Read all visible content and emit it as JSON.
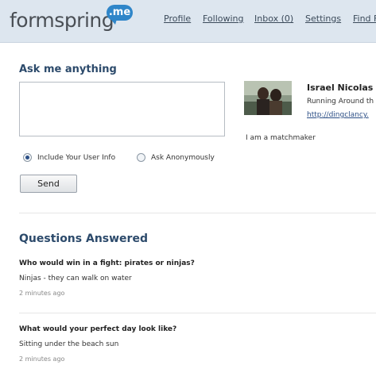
{
  "header": {
    "logo_text": "formspring",
    "logo_badge": ".me",
    "nav": [
      "Profile",
      "Following",
      "Inbox (0)",
      "Settings",
      "Find F"
    ]
  },
  "ask": {
    "title": "Ask me anything",
    "textarea_value": "",
    "option_user_info": "Include Your User Info",
    "option_anonymous": "Ask Anonymously",
    "selected_option": "Include Your User Info",
    "send_label": "Send"
  },
  "profile": {
    "name": "Israel Nicolas",
    "location": "Running Around th",
    "link": "http://dingclancy.",
    "bio": "I am a matchmaker"
  },
  "questions": {
    "title": "Questions Answered",
    "items": [
      {
        "question": "Who would win in a fight: pirates or ninjas?",
        "answer": "Ninjas - they can walk on water",
        "time": "2 minutes ago"
      },
      {
        "question": "What would your perfect day look like?",
        "answer": "Sitting under the beach sun",
        "time": "2 minutes ago"
      }
    ]
  },
  "colors": {
    "header_bg": "#dde6ef",
    "heading": "#2c4a6b",
    "logo_badge": "#2f86c9"
  }
}
